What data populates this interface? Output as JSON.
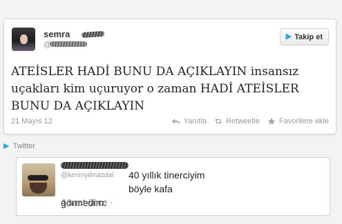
{
  "tweet": {
    "user_name": "semra",
    "screen_name": "@",
    "follow_button_label": "Takip et",
    "text": "ATEİSLER HADİ BUNU DA AÇIKLAYIN insansız uçakları kim uçuruyor o zaman HADİ ATEİSLER BUNU DA AÇIKLAYIN",
    "date": "21 Mayıs 12",
    "actions": {
      "reply": "Yanıtla",
      "retweet": "Retweetle",
      "favorite": "Favorilere ekle"
    }
  },
  "footer": {
    "label": "Twitter"
  },
  "reply": {
    "handle": "@kerimyilmazdal",
    "text_line_1": "40 yıllık tinerciyim böyle kafa",
    "text_line_2": "görmedim.",
    "time": "4 saat önce",
    "separator": "·"
  },
  "colors": {
    "accent": "#2fa8e0",
    "muted": "#999999",
    "text": "#222222"
  },
  "icons": {
    "follow": "twitter-bird-icon",
    "reply": "reply-arrow-icon",
    "retweet": "retweet-icon",
    "favorite": "star-icon"
  }
}
